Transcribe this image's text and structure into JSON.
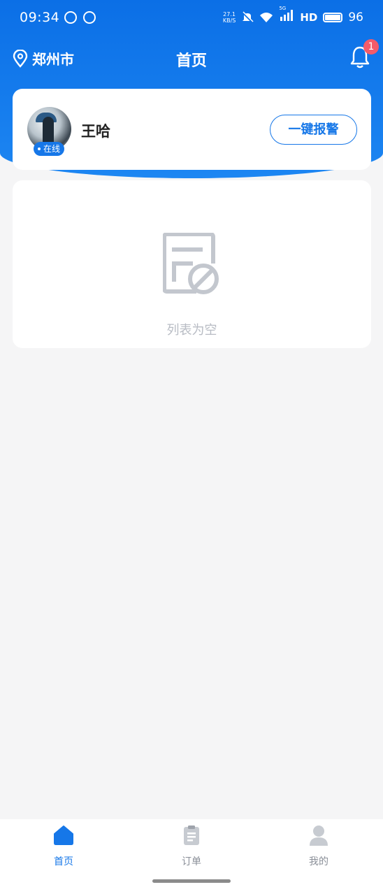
{
  "status_bar": {
    "time": "09:34",
    "speed_top": "27.1",
    "speed_bottom": "KB/S",
    "network": "5G",
    "hd": "HD",
    "battery": "96"
  },
  "header": {
    "location": "郑州市",
    "title": "首页",
    "notification_count": "1"
  },
  "user": {
    "name": "王哈",
    "status": "在线",
    "sos_label": "一键报警"
  },
  "list": {
    "empty_text": "列表为空"
  },
  "tabs": [
    {
      "label": "首页",
      "icon": "home-icon",
      "active": true
    },
    {
      "label": "订单",
      "icon": "clipboard-icon",
      "active": false
    },
    {
      "label": "我的",
      "icon": "user-icon",
      "active": false
    }
  ],
  "colors": {
    "primary": "#1677e8",
    "badge": "#f45b69",
    "background": "#f5f5f6"
  }
}
